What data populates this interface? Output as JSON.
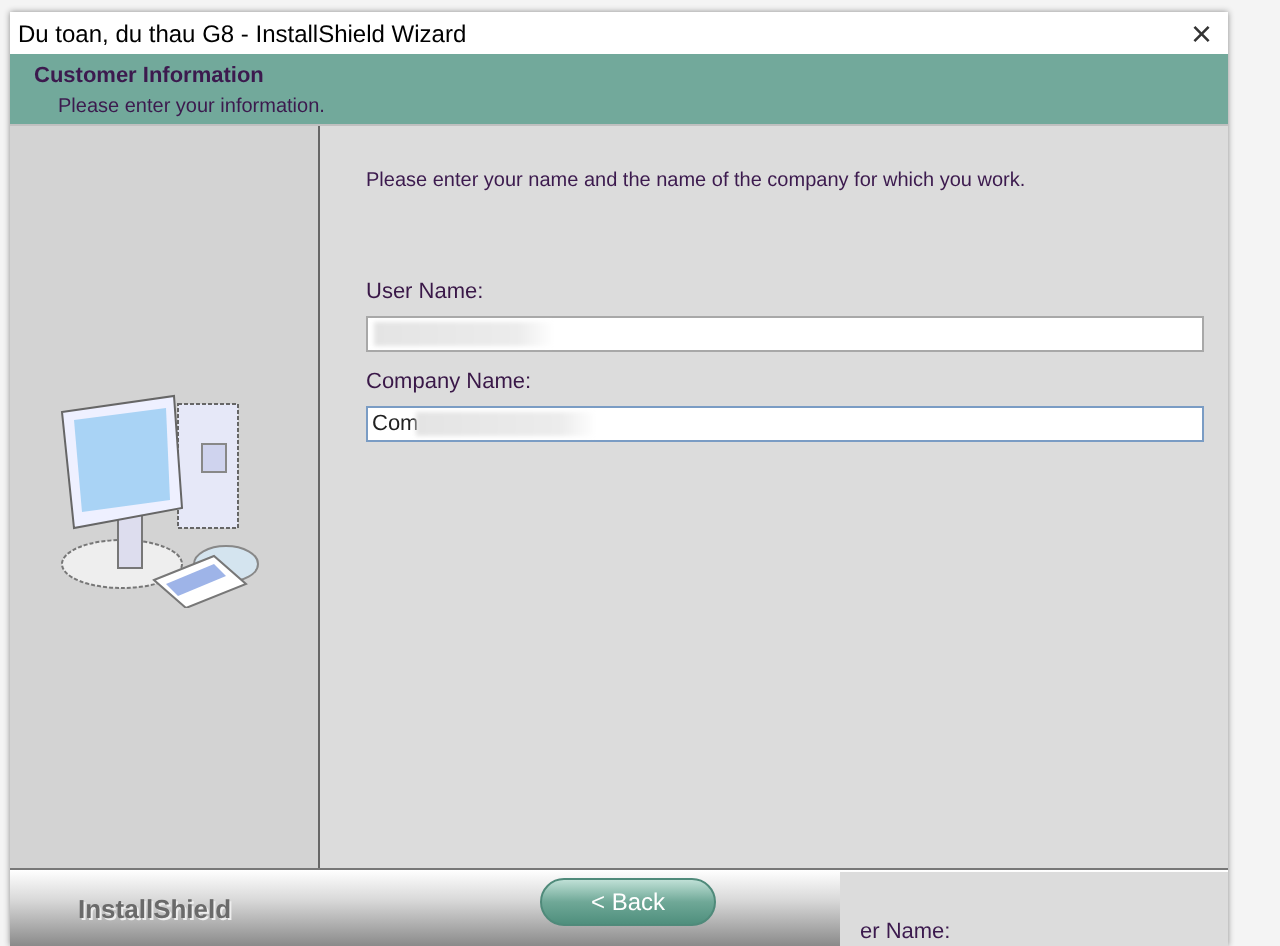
{
  "window": {
    "title": "Du toan, du thau G8 - InstallShield Wizard",
    "close": "×"
  },
  "header": {
    "title": "Customer Information",
    "subtitle": "Please enter your information."
  },
  "instructions": "Please enter your name and the name of the company for which you work.",
  "fields": [
    {
      "label": "User Name:",
      "redacted": true,
      "focused": false
    },
    {
      "label": "Company Name:",
      "value": "Com",
      "redacted": true,
      "focused": true
    }
  ],
  "footer": {
    "brand": "InstallShield",
    "back_button": "< Back"
  },
  "background_fragment": "er Name:"
}
